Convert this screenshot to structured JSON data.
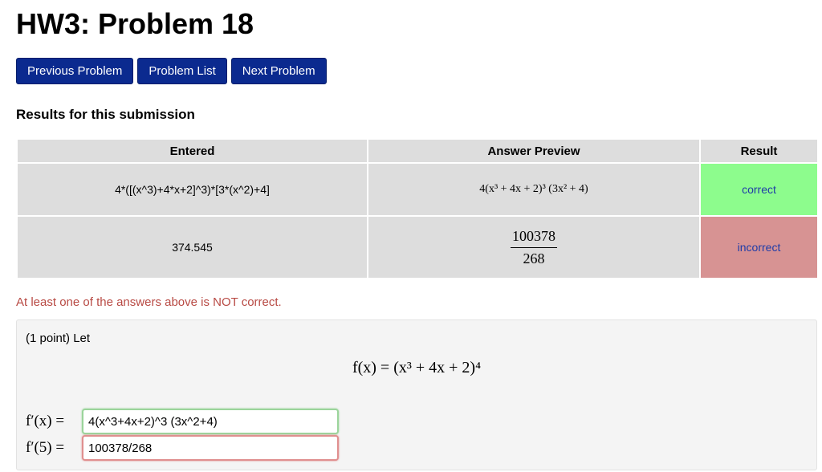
{
  "page": {
    "title": "HW3: Problem 18"
  },
  "nav": {
    "previous_label": "Previous Problem",
    "list_label": "Problem List",
    "next_label": "Next Problem"
  },
  "results": {
    "heading": "Results for this submission",
    "headers": [
      "Entered",
      "Answer Preview",
      "Result"
    ],
    "rows": [
      {
        "entered": "4*([(x^3)+4*x+2]^3)*[3*(x^2)+4]",
        "preview": "4(x³ + 4x + 2)³ (3x² + 4)",
        "result": "correct"
      },
      {
        "entered": "374.545",
        "preview_numerator": "100378",
        "preview_denominator": "268",
        "result": "incorrect"
      }
    ],
    "warning": "At least one of the answers above is NOT correct."
  },
  "problem": {
    "intro": "(1 point) Let",
    "equation": "f(x) = (x³ + 4x + 2)⁴",
    "answers": [
      {
        "label": "f′(x) =",
        "value": "4(x^3+4x+2)^3 (3x^2+4)",
        "status": "correct"
      },
      {
        "label": "f′(5) =",
        "value": "100378/268",
        "status": "incorrect"
      }
    ]
  },
  "colors": {
    "nav_button_bg": "#0b2a8f",
    "correct_bg": "#8dfc8d",
    "incorrect_bg": "#d79393",
    "warning_text": "#b84a44",
    "result_text": "#1f3ca8"
  }
}
